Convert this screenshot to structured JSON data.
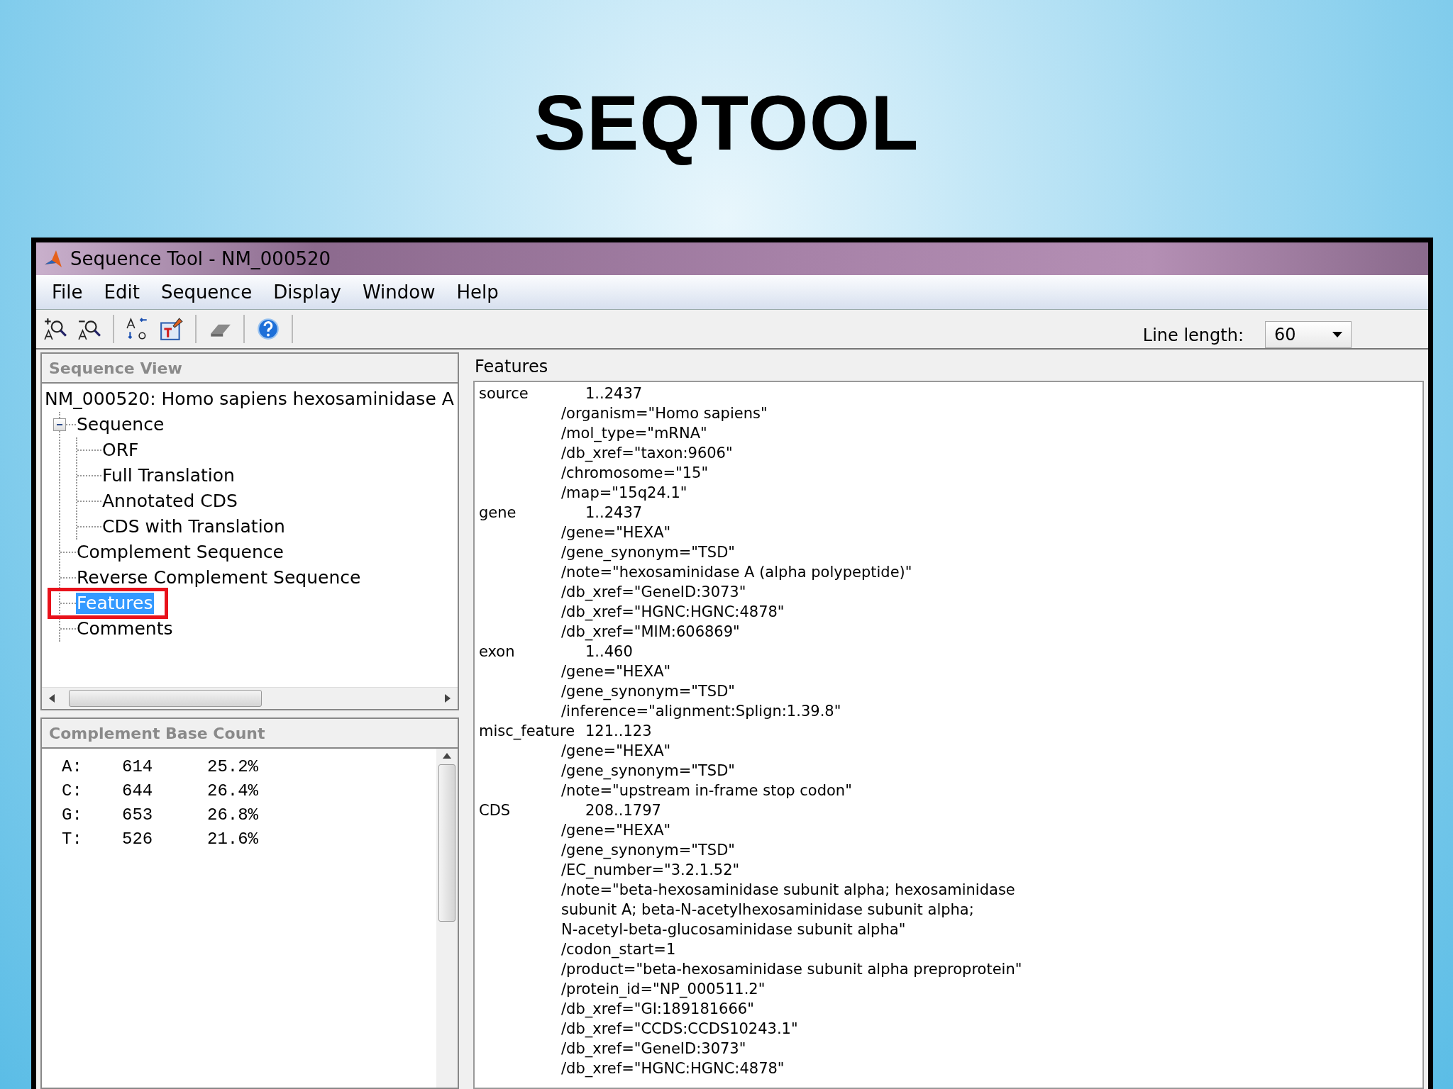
{
  "slide_title": "SEQTOOL",
  "window": {
    "title": "Sequence Tool - NM_000520"
  },
  "menu": [
    "File",
    "Edit",
    "Sequence",
    "Display",
    "Window",
    "Help"
  ],
  "toolbar": {
    "tools": [
      {
        "kind": "zoom-in"
      },
      {
        "kind": "zoom-out"
      },
      {
        "kind": "sep"
      },
      {
        "kind": "case"
      },
      {
        "kind": "edit"
      },
      {
        "kind": "sep"
      },
      {
        "kind": "eraser"
      },
      {
        "kind": "sep"
      },
      {
        "kind": "help"
      },
      {
        "kind": "sep"
      }
    ],
    "line_length_label": "Line length:",
    "line_length_value": "60"
  },
  "sequence_view": {
    "title": "Sequence View",
    "tree": {
      "label": "NM_000520: Homo sapiens hexosaminidase A",
      "children": [
        {
          "label": "Sequence",
          "expanded": true,
          "selected": false,
          "children": [
            {
              "label": "ORF",
              "selected": false
            },
            {
              "label": "Full Translation",
              "selected": false
            },
            {
              "label": "Annotated CDS",
              "selected": false
            },
            {
              "label": "CDS with Translation",
              "selected": false
            }
          ]
        },
        {
          "label": "Complement Sequence",
          "selected": false
        },
        {
          "label": "Reverse Complement Sequence",
          "selected": false
        },
        {
          "label": "Features",
          "selected": true,
          "highlighted": true
        },
        {
          "label": "Comments",
          "selected": false
        }
      ]
    }
  },
  "base_count": {
    "title": "Complement Base Count",
    "rows": [
      {
        "base": "A:",
        "count": "614",
        "percent": "25.2%"
      },
      {
        "base": "C:",
        "count": "644",
        "percent": "26.4%"
      },
      {
        "base": "G:",
        "count": "653",
        "percent": "26.8%"
      },
      {
        "base": "T:",
        "count": "526",
        "percent": "21.6%"
      }
    ]
  },
  "features": {
    "title": "Features",
    "entries": [
      {
        "key": "source",
        "location": "1..2437",
        "qualifiers": [
          "/organism=\"Homo sapiens\"",
          "/mol_type=\"mRNA\"",
          "/db_xref=\"taxon:9606\"",
          "/chromosome=\"15\"",
          "/map=\"15q24.1\""
        ]
      },
      {
        "key": "gene",
        "location": "1..2437",
        "qualifiers": [
          "/gene=\"HEXA\"",
          "/gene_synonym=\"TSD\"",
          "/note=\"hexosaminidase A (alpha polypeptide)\"",
          "/db_xref=\"GeneID:3073\"",
          "/db_xref=\"HGNC:HGNC:4878\"",
          "/db_xref=\"MIM:606869\""
        ]
      },
      {
        "key": "exon",
        "location": "1..460",
        "qualifiers": [
          "/gene=\"HEXA\"",
          "/gene_synonym=\"TSD\"",
          "/inference=\"alignment:Splign:1.39.8\""
        ]
      },
      {
        "key": "misc_feature",
        "location": "121..123",
        "qualifiers": [
          "/gene=\"HEXA\"",
          "/gene_synonym=\"TSD\"",
          "/note=\"upstream in-frame stop codon\""
        ]
      },
      {
        "key": "CDS",
        "location": "208..1797",
        "qualifiers": [
          "/gene=\"HEXA\"",
          "/gene_synonym=\"TSD\"",
          "/EC_number=\"3.2.1.52\"",
          "/note=\"beta-hexosaminidase subunit alpha; hexosaminidase",
          "subunit A; beta-N-acetylhexosaminidase subunit alpha;",
          "N-acetyl-beta-glucosaminidase subunit alpha\"",
          "/codon_start=1",
          "/product=\"beta-hexosaminidase subunit alpha preproprotein\"",
          "/protein_id=\"NP_000511.2\"",
          "/db_xref=\"GI:189181666\"",
          "/db_xref=\"CCDS:CCDS10243.1\"",
          "/db_xref=\"GeneID:3073\"",
          "/db_xref=\"HGNC:HGNC:4878\""
        ]
      }
    ]
  }
}
